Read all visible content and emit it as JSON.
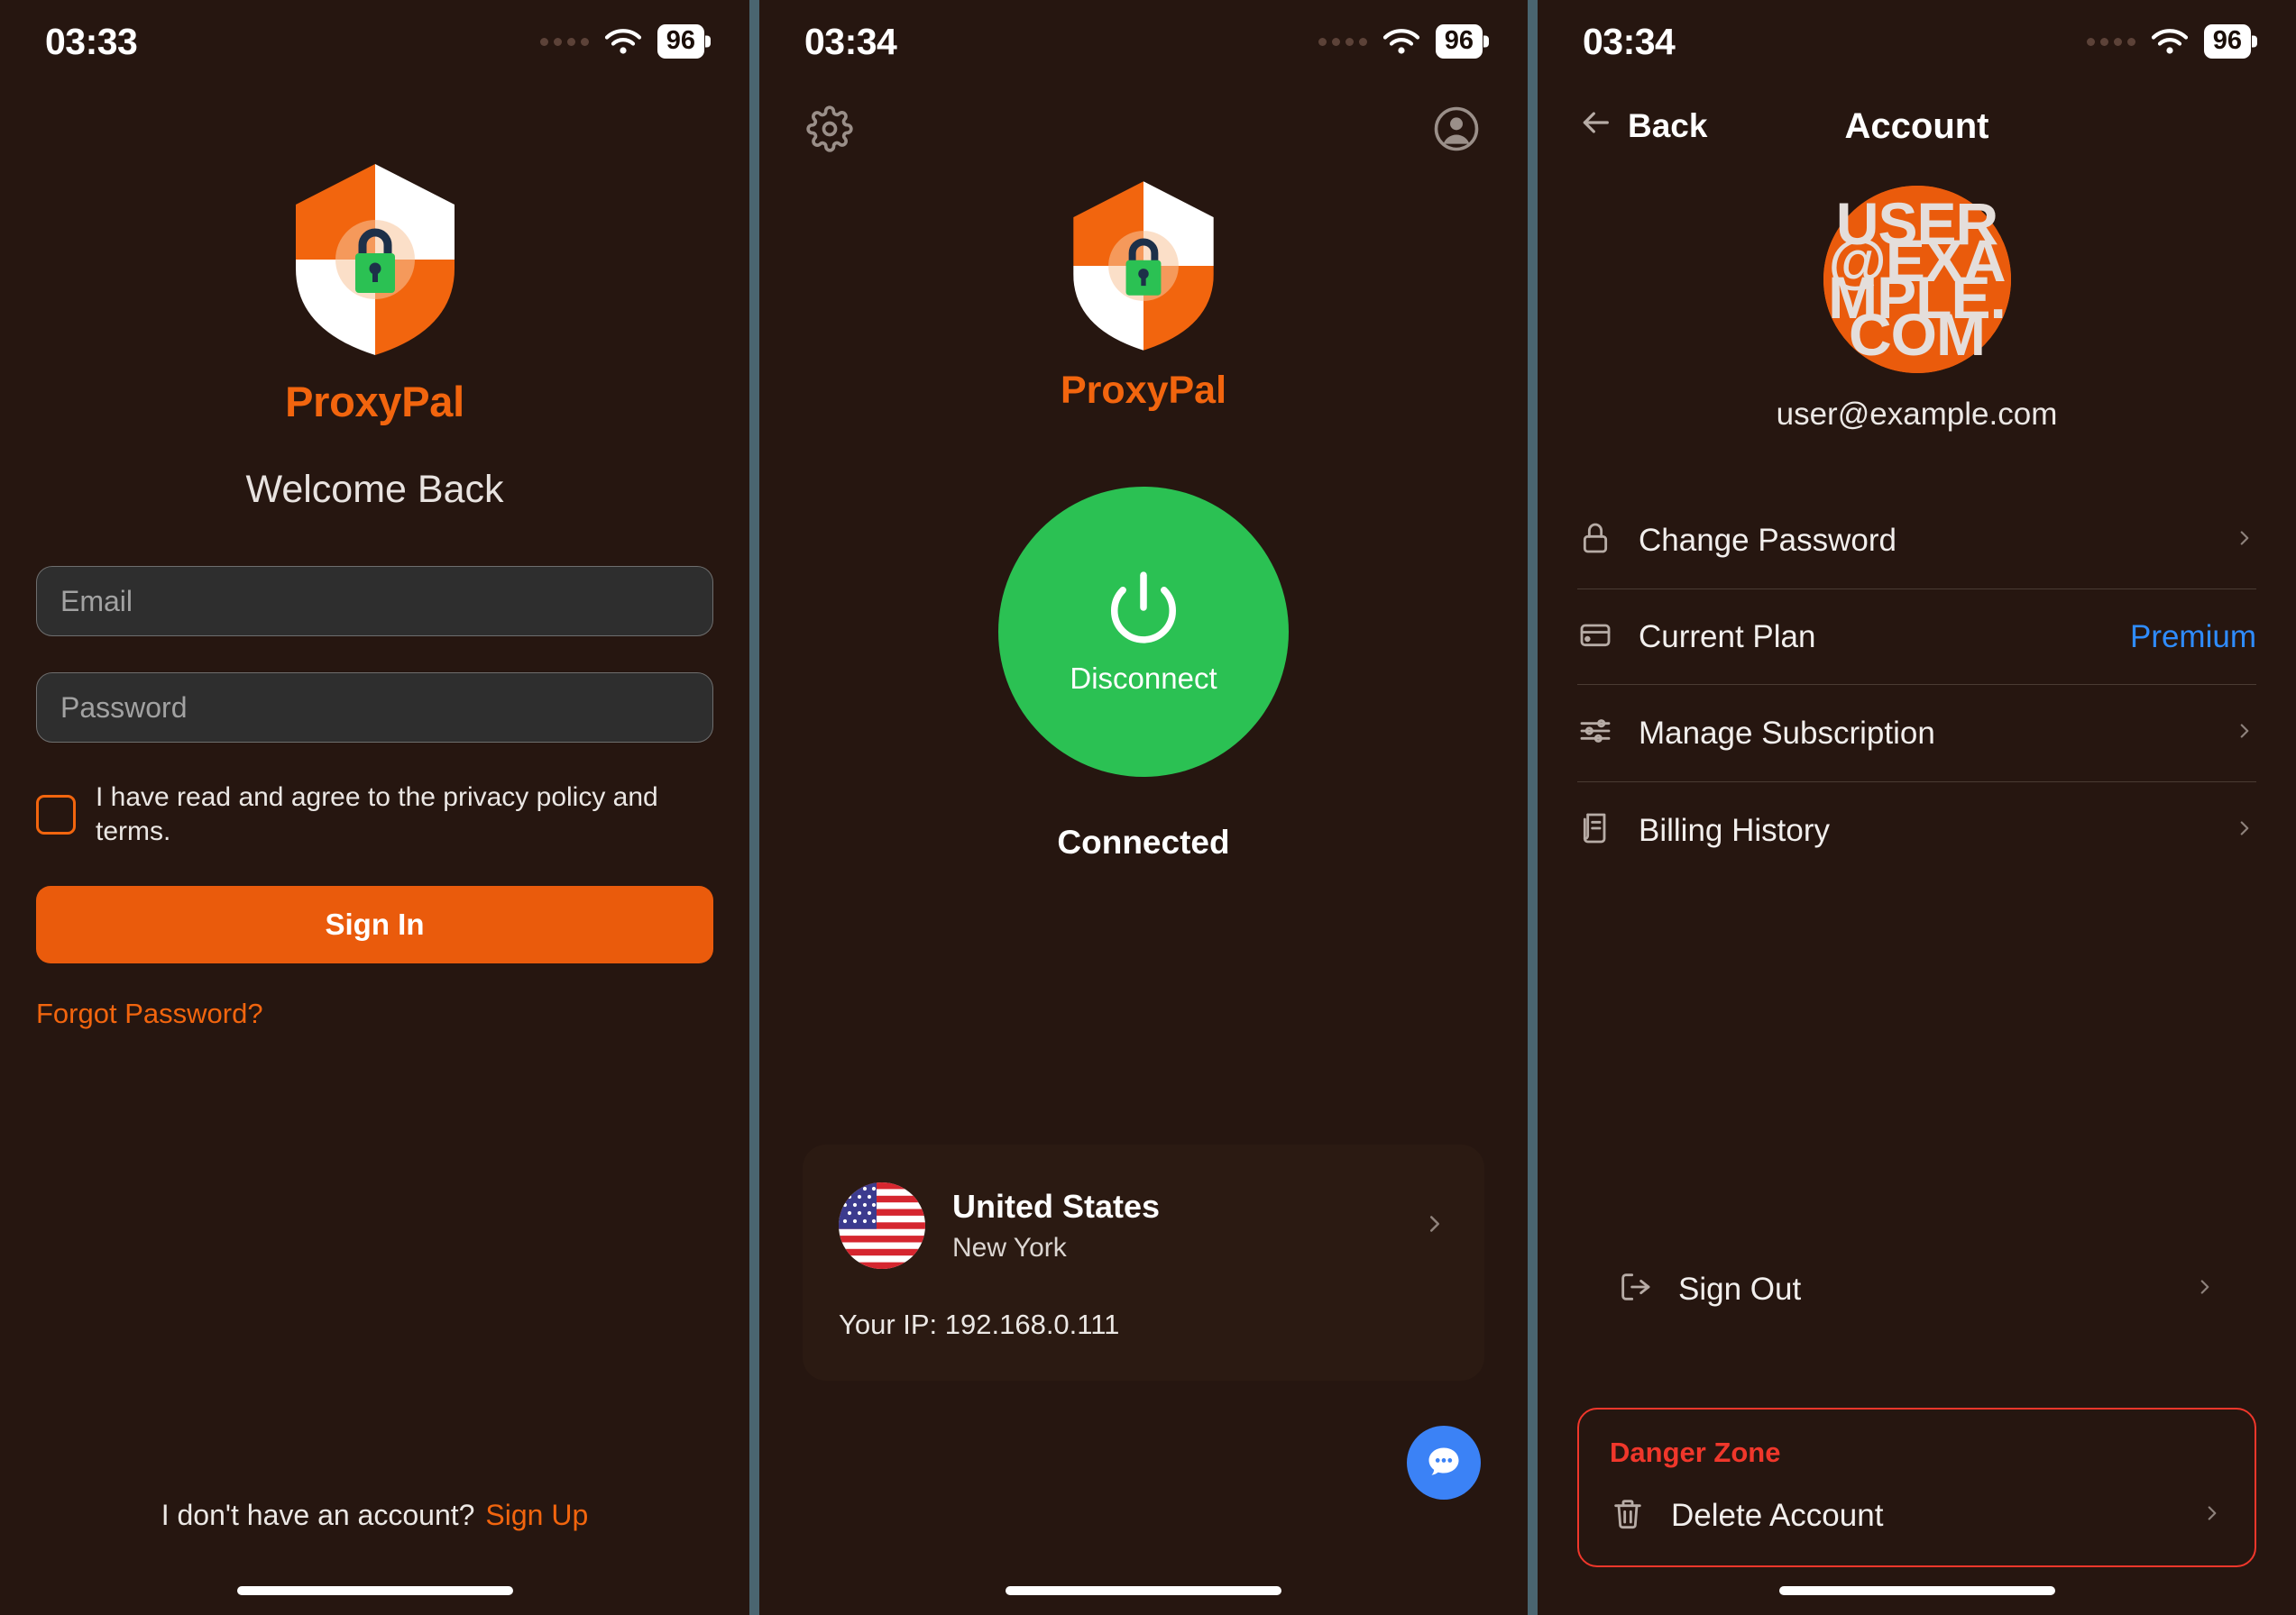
{
  "status_bar": {
    "time_screen1": "03:33",
    "time_screen2": "03:34",
    "time_screen3": "03:34",
    "battery": "96",
    "wifi_icon": "wifi-icon",
    "signal_icon": "signal-dots-icon"
  },
  "theme": {
    "background": "#261610",
    "accent_orange": "#f2650e",
    "button_orange": "#ea5b0c",
    "connected_green": "#2bc153",
    "link_blue": "#2f8cff",
    "danger_red": "#f0372b",
    "fab_blue": "#3b82f6",
    "divider_slate": "#4a6570"
  },
  "login": {
    "brand": "ProxyPal",
    "heading": "Welcome Back",
    "email_placeholder": "Email",
    "email_value": "",
    "password_placeholder": "Password",
    "password_value": "",
    "agree_text": "I have read and agree to the privacy policy and terms.",
    "agree_checked": false,
    "sign_in_label": "Sign In",
    "forgot_label": "Forgot Password?",
    "footer_prompt": "I don't have an account?",
    "footer_link": "Sign Up",
    "logo_icon": "shield-lock-icon",
    "checkbox_icon": "checkbox-unchecked-icon"
  },
  "home": {
    "brand": "ProxyPal",
    "settings_icon": "gear-icon",
    "account_icon": "account-circle-icon",
    "power_icon": "power-icon",
    "power_label": "Disconnect",
    "status_label": "Connected",
    "server": {
      "flag_icon": "us-flag-icon",
      "country": "United States",
      "city": "New York",
      "chevron_icon": "chevron-right-icon"
    },
    "ip_label": "Your IP: 192.168.0.111",
    "chat_fab_icon": "chat-bubble-icon"
  },
  "account": {
    "back_label": "Back",
    "back_icon": "arrow-left-icon",
    "title": "Account",
    "avatar_text": "user@example.com",
    "email": "user@example.com",
    "rows": [
      {
        "icon": "lock-icon",
        "label": "Change Password",
        "value": "",
        "trailing": "chevron-right-icon"
      },
      {
        "icon": "credit-card-icon",
        "label": "Current Plan",
        "value": "Premium",
        "trailing": ""
      },
      {
        "icon": "sliders-icon",
        "label": "Manage Subscription",
        "value": "",
        "trailing": "chevron-right-icon"
      },
      {
        "icon": "receipt-icon",
        "label": "Billing History",
        "value": "",
        "trailing": "chevron-right-icon"
      }
    ],
    "sign_out": {
      "icon": "logout-icon",
      "label": "Sign Out",
      "trailing": "chevron-right-icon"
    },
    "danger": {
      "title": "Danger Zone",
      "delete": {
        "icon": "trash-icon",
        "label": "Delete Account",
        "trailing": "chevron-right-icon"
      }
    }
  }
}
